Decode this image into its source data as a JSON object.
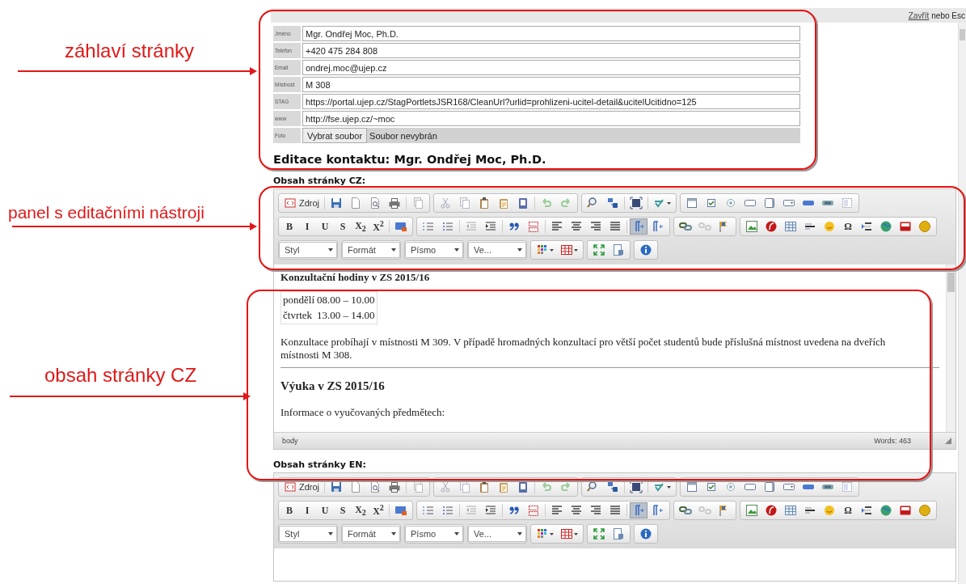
{
  "top_bar": {
    "close_link": "Zavřít",
    "close_hint": "nebo Esc"
  },
  "contact_form": {
    "fields": [
      {
        "kind": "text",
        "label": "Jméno",
        "value": "Mgr. Ondřej Moc, Ph.D."
      },
      {
        "kind": "text",
        "label": "Telefon",
        "value": "+420 475 284 808"
      },
      {
        "kind": "text",
        "label": "Email",
        "value": "ondrej.moc@ujep.cz"
      },
      {
        "kind": "text",
        "label": "Místnost",
        "value": "M 308"
      },
      {
        "kind": "text",
        "label": "STAG",
        "value": "https://portal.ujep.cz/StagPortletsJSR168/CleanUrl?urlid=prohlizeni-ucitel-detail&ucitelUcitidno=125"
      },
      {
        "kind": "text",
        "label": "www",
        "value": "http://fse.ujep.cz/~moc"
      },
      {
        "kind": "file",
        "label": "Foto",
        "button": "Vybrat soubor",
        "status": "Soubor nevybrán"
      }
    ]
  },
  "heading": "Editace kontaktu: Mgr. Ondřej Moc, Ph.D.",
  "editors": [
    {
      "title": "Obsah stránky CZ:",
      "toolbar": {
        "rows": [
          {
            "groups": [
              {
                "sets": [
                  [
                    {
                      "kind": "source",
                      "label": "Zdroj",
                      "on": false
                    }
                  ],
                  [
                    {
                      "kind": "save",
                      "on": false
                    },
                    {
                      "kind": "newpage",
                      "on": false
                    },
                    {
                      "kind": "preview",
                      "on": false
                    },
                    {
                      "kind": "print",
                      "on": false
                    }
                  ],
                  [
                    {
                      "kind": "templates",
                      "on": false
                    }
                  ]
                ]
              },
              {
                "sets": [
                  [
                    {
                      "kind": "cut",
                      "on": false
                    },
                    {
                      "kind": "copy",
                      "on": false
                    },
                    {
                      "kind": "paste",
                      "on": false
                    },
                    {
                      "kind": "pastetext",
                      "on": false
                    },
                    {
                      "kind": "pasteword",
                      "on": false
                    }
                  ],
                  [
                    {
                      "kind": "undo",
                      "on": false
                    },
                    {
                      "kind": "redo",
                      "on": false
                    }
                  ]
                ]
              },
              {
                "sets": [
                  [
                    {
                      "kind": "find",
                      "on": false
                    },
                    {
                      "kind": "replace",
                      "on": false
                    }
                  ],
                  [
                    {
                      "kind": "selectall",
                      "on": false
                    }
                  ],
                  [
                    {
                      "kind": "spellcheck",
                      "on": false
                    }
                  ]
                ]
              },
              {
                "sets": [
                  [
                    {
                      "kind": "form",
                      "on": false
                    },
                    {
                      "kind": "checkbox",
                      "on": false
                    },
                    {
                      "kind": "radio",
                      "on": false
                    },
                    {
                      "kind": "textfield",
                      "on": false
                    },
                    {
                      "kind": "textarea",
                      "on": false
                    },
                    {
                      "kind": "select",
                      "on": false
                    },
                    {
                      "kind": "formbutton",
                      "on": false
                    },
                    {
                      "kind": "imagebutton",
                      "on": false
                    },
                    {
                      "kind": "hidden",
                      "on": false
                    }
                  ]
                ]
              }
            ]
          },
          {
            "groups": [
              {
                "sets": [
                  [
                    {
                      "kind": "bold",
                      "label": "B",
                      "on": false
                    },
                    {
                      "kind": "italic",
                      "label": "I",
                      "on": false
                    },
                    {
                      "kind": "underline",
                      "label": "U",
                      "on": false
                    },
                    {
                      "kind": "strike",
                      "label": "S",
                      "on": false
                    },
                    {
                      "kind": "subscript",
                      "label": "X$_{2}$",
                      "on": false
                    },
                    {
                      "kind": "superscript",
                      "label": "X$^{2}$",
                      "on": false
                    }
                  ],
                  [
                    {
                      "kind": "removeformat",
                      "on": false
                    }
                  ]
                ]
              },
              {
                "sets": [
                  [
                    {
                      "kind": "numberedlist",
                      "on": false
                    },
                    {
                      "kind": "bulletlist",
                      "on": false
                    }
                  ],
                  [
                    {
                      "kind": "outdent",
                      "on": false
                    },
                    {
                      "kind": "indent",
                      "on": false
                    }
                  ],
                  [
                    {
                      "kind": "blockquote",
                      "on": false
                    },
                    {
                      "kind": "div",
                      "on": false
                    }
                  ],
                  [
                    {
                      "kind": "alignleft",
                      "on": false
                    },
                    {
                      "kind": "aligncenter",
                      "on": false
                    },
                    {
                      "kind": "alignright",
                      "on": false
                    },
                    {
                      "kind": "justify",
                      "on": false
                    }
                  ],
                  [
                    {
                      "kind": "ltr",
                      "on": true
                    },
                    {
                      "kind": "rtl",
                      "on": false
                    }
                  ]
                ]
              },
              {
                "sets": [
                  [
                    {
                      "kind": "link",
                      "on": false
                    },
                    {
                      "kind": "unlink",
                      "on": false
                    },
                    {
                      "kind": "anchor",
                      "on": false
                    }
                  ]
                ]
              },
              {
                "sets": [
                  [
                    {
                      "kind": "image",
                      "on": false
                    },
                    {
                      "kind": "flash",
                      "on": false
                    },
                    {
                      "kind": "table",
                      "on": false
                    },
                    {
                      "kind": "hr",
                      "on": false
                    },
                    {
                      "kind": "smiley",
                      "on": false
                    },
                    {
                      "kind": "specialchar",
                      "label": "Ω",
                      "on": false
                    },
                    {
                      "kind": "pagebreak",
                      "on": false
                    },
                    {
                      "kind": "iframe",
                      "on": false
                    },
                    {
                      "kind": "youtube",
                      "on": false
                    },
                    {
                      "kind": "coin",
                      "on": false
                    }
                  ]
                ]
              }
            ]
          },
          {
            "groups": [
              {
                "sets": [
                  [
                    {
                      "kind": "combo",
                      "label": "Styl",
                      "on": false
                    }
                  ]
                ]
              },
              {
                "sets": [
                  [
                    {
                      "kind": "combo",
                      "label": "Formát",
                      "on": false
                    }
                  ]
                ]
              },
              {
                "sets": [
                  [
                    {
                      "kind": "combo",
                      "label": "Písmo",
                      "on": false
                    }
                  ]
                ]
              },
              {
                "sets": [
                  [
                    {
                      "kind": "combo",
                      "label": "Ve...",
                      "on": false
                    }
                  ]
                ]
              },
              {
                "sets": [
                  [
                    {
                      "kind": "textcolor",
                      "on": false
                    },
                    {
                      "kind": "bgcolor",
                      "on": false
                    }
                  ]
                ]
              },
              {
                "sets": [
                  [
                    {
                      "kind": "maximize",
                      "on": false
                    },
                    {
                      "kind": "showblocks",
                      "on": false
                    }
                  ]
                ]
              },
              {
                "sets": [
                  [
                    {
                      "kind": "about",
                      "on": false
                    }
                  ]
                ]
              }
            ]
          }
        ]
      },
      "content": [
        {
          "kind": "heading",
          "text": "Konzultační hodiny v ZS 2015/16"
        },
        {
          "kind": "table",
          "rows": [
            [
              "pondělí",
              "08.00 – 10.00"
            ],
            [
              "čtvrtek",
              "13.00 – 14.00"
            ]
          ]
        },
        {
          "kind": "paragraph",
          "text": "Konzultace probíhají v místnosti M 309. V případě hromadných konzultací pro větší počet studentů bude příslušná místnost uvedena na dveřích místnosti M 308."
        },
        {
          "kind": "rule"
        },
        {
          "kind": "subheading",
          "text": "Výuka v ZS 2015/16"
        },
        {
          "kind": "paragraph",
          "text": "Informace o vyučovaných předmětech:"
        }
      ],
      "status": {
        "path": "body",
        "words": "Words: 463"
      }
    },
    {
      "title": "Obsah stránky EN:",
      "toolbar": {
        "rows": [
          {
            "groups": [
              {
                "sets": [
                  [
                    {
                      "kind": "source",
                      "label": "Zdroj",
                      "on": false
                    }
                  ],
                  [
                    {
                      "kind": "save",
                      "on": false
                    },
                    {
                      "kind": "newpage",
                      "on": false
                    },
                    {
                      "kind": "preview",
                      "on": false
                    },
                    {
                      "kind": "print",
                      "on": false
                    }
                  ],
                  [
                    {
                      "kind": "templates",
                      "on": false
                    }
                  ]
                ]
              },
              {
                "sets": [
                  [
                    {
                      "kind": "cut",
                      "on": false
                    },
                    {
                      "kind": "copy",
                      "on": false
                    },
                    {
                      "kind": "paste",
                      "on": false
                    },
                    {
                      "kind": "pastetext",
                      "on": false
                    },
                    {
                      "kind": "pasteword",
                      "on": false
                    }
                  ],
                  [
                    {
                      "kind": "undo",
                      "on": false
                    },
                    {
                      "kind": "redo",
                      "on": false
                    }
                  ]
                ]
              },
              {
                "sets": [
                  [
                    {
                      "kind": "find",
                      "on": false
                    },
                    {
                      "kind": "replace",
                      "on": false
                    }
                  ],
                  [
                    {
                      "kind": "selectall",
                      "on": false
                    }
                  ],
                  [
                    {
                      "kind": "spellcheck",
                      "on": false
                    }
                  ]
                ]
              },
              {
                "sets": [
                  [
                    {
                      "kind": "form",
                      "on": false
                    },
                    {
                      "kind": "checkbox",
                      "on": false
                    },
                    {
                      "kind": "radio",
                      "on": false
                    },
                    {
                      "kind": "textfield",
                      "on": false
                    },
                    {
                      "kind": "textarea",
                      "on": false
                    },
                    {
                      "kind": "select",
                      "on": false
                    },
                    {
                      "kind": "formbutton",
                      "on": false
                    },
                    {
                      "kind": "imagebutton",
                      "on": false
                    },
                    {
                      "kind": "hidden",
                      "on": false
                    }
                  ]
                ]
              }
            ]
          },
          {
            "groups": [
              {
                "sets": [
                  [
                    {
                      "kind": "bold",
                      "label": "B",
                      "on": false
                    },
                    {
                      "kind": "italic",
                      "label": "I",
                      "on": false
                    },
                    {
                      "kind": "underline",
                      "label": "U",
                      "on": false
                    },
                    {
                      "kind": "strike",
                      "label": "S",
                      "on": false
                    },
                    {
                      "kind": "subscript",
                      "label": "X$_{2}$",
                      "on": false
                    },
                    {
                      "kind": "superscript",
                      "label": "X$^{2}$",
                      "on": false
                    }
                  ],
                  [
                    {
                      "kind": "removeformat",
                      "on": false
                    }
                  ]
                ]
              },
              {
                "sets": [
                  [
                    {
                      "kind": "numberedlist",
                      "on": false
                    },
                    {
                      "kind": "bulletlist",
                      "on": false
                    }
                  ],
                  [
                    {
                      "kind": "outdent",
                      "on": false
                    },
                    {
                      "kind": "indent",
                      "on": false
                    }
                  ],
                  [
                    {
                      "kind": "blockquote",
                      "on": false
                    },
                    {
                      "kind": "div",
                      "on": false
                    }
                  ],
                  [
                    {
                      "kind": "alignleft",
                      "on": false
                    },
                    {
                      "kind": "aligncenter",
                      "on": false
                    },
                    {
                      "kind": "alignright",
                      "on": false
                    },
                    {
                      "kind": "justify",
                      "on": false
                    }
                  ],
                  [
                    {
                      "kind": "ltr",
                      "on": true
                    },
                    {
                      "kind": "rtl",
                      "on": false
                    }
                  ]
                ]
              },
              {
                "sets": [
                  [
                    {
                      "kind": "link",
                      "on": false
                    },
                    {
                      "kind": "unlink",
                      "on": false
                    },
                    {
                      "kind": "anchor",
                      "on": false
                    }
                  ]
                ]
              },
              {
                "sets": [
                  [
                    {
                      "kind": "image",
                      "on": false
                    },
                    {
                      "kind": "flash",
                      "on": false
                    },
                    {
                      "kind": "table",
                      "on": false
                    },
                    {
                      "kind": "hr",
                      "on": false
                    },
                    {
                      "kind": "smiley",
                      "on": false
                    },
                    {
                      "kind": "specialchar",
                      "label": "Ω",
                      "on": false
                    },
                    {
                      "kind": "pagebreak",
                      "on": false
                    },
                    {
                      "kind": "iframe",
                      "on": false
                    },
                    {
                      "kind": "youtube",
                      "on": false
                    },
                    {
                      "kind": "coin",
                      "on": false
                    }
                  ]
                ]
              }
            ]
          },
          {
            "groups": [
              {
                "sets": [
                  [
                    {
                      "kind": "combo",
                      "label": "Styl",
                      "on": false
                    }
                  ]
                ]
              },
              {
                "sets": [
                  [
                    {
                      "kind": "combo",
                      "label": "Formát",
                      "on": false
                    }
                  ]
                ]
              },
              {
                "sets": [
                  [
                    {
                      "kind": "combo",
                      "label": "Písmo",
                      "on": false
                    }
                  ]
                ]
              },
              {
                "sets": [
                  [
                    {
                      "kind": "combo",
                      "label": "Ve...",
                      "on": false
                    }
                  ]
                ]
              },
              {
                "sets": [
                  [
                    {
                      "kind": "textcolor",
                      "on": false
                    },
                    {
                      "kind": "bgcolor",
                      "on": false
                    }
                  ]
                ]
              },
              {
                "sets": [
                  [
                    {
                      "kind": "maximize",
                      "on": false
                    },
                    {
                      "kind": "showblocks",
                      "on": false
                    }
                  ]
                ]
              },
              {
                "sets": [
                  [
                    {
                      "kind": "about",
                      "on": false
                    }
                  ]
                ]
              }
            ]
          }
        ]
      }
    }
  ],
  "annotations": [
    {
      "label": "záhlaví stránky"
    },
    {
      "label": "panel s editačními nástroji"
    },
    {
      "label": "obsah stránky CZ"
    }
  ]
}
